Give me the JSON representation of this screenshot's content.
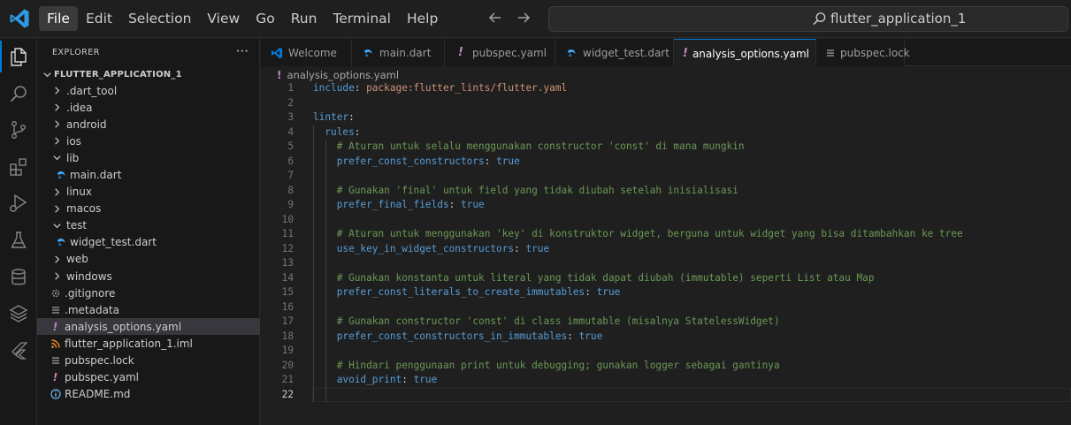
{
  "menu": [
    "File",
    "Edit",
    "Selection",
    "View",
    "Go",
    "Run",
    "Terminal",
    "Help"
  ],
  "search": {
    "text": "flutter_application_1"
  },
  "colors": {
    "accent": "#0078d4",
    "yaml_icon": "#c586c0",
    "dart_icon": "#42a5f5",
    "xml_icon": "#f08a24"
  },
  "explorer": {
    "title": "EXPLORER",
    "more": "···",
    "root": "FLUTTER_APPLICATION_1",
    "items": [
      {
        "label": ".dart_tool",
        "kind": "folder",
        "icon": "chevron-right-icon"
      },
      {
        "label": ".idea",
        "kind": "folder",
        "icon": "chevron-right-icon"
      },
      {
        "label": "android",
        "kind": "folder",
        "icon": "chevron-right-icon"
      },
      {
        "label": "ios",
        "kind": "folder",
        "icon": "chevron-right-icon"
      },
      {
        "label": "lib",
        "kind": "folder-open",
        "icon": "chevron-down-icon"
      },
      {
        "label": "main.dart",
        "kind": "dart",
        "icon": "dart-icon"
      },
      {
        "label": "linux",
        "kind": "folder",
        "icon": "chevron-right-icon"
      },
      {
        "label": "macos",
        "kind": "folder",
        "icon": "chevron-right-icon"
      },
      {
        "label": "test",
        "kind": "folder-open",
        "icon": "chevron-down-icon"
      },
      {
        "label": "widget_test.dart",
        "kind": "dart",
        "icon": "dart-icon"
      },
      {
        "label": "web",
        "kind": "folder",
        "icon": "chevron-right-icon"
      },
      {
        "label": "windows",
        "kind": "folder",
        "icon": "chevron-right-icon"
      },
      {
        "label": ".gitignore",
        "kind": "gear",
        "icon": "gear-icon"
      },
      {
        "label": ".metadata",
        "kind": "lines",
        "icon": "lines-icon"
      },
      {
        "label": "analysis_options.yaml",
        "kind": "yaml",
        "icon": "exclamation-icon",
        "selected": true
      },
      {
        "label": "flutter_application_1.iml",
        "kind": "xml",
        "icon": "rss-icon"
      },
      {
        "label": "pubspec.lock",
        "kind": "lines",
        "icon": "lines-icon"
      },
      {
        "label": "pubspec.yaml",
        "kind": "yaml",
        "icon": "exclamation-icon"
      },
      {
        "label": "README.md",
        "kind": "info",
        "icon": "info-icon"
      }
    ]
  },
  "tabs": [
    {
      "label": "Welcome",
      "kind": "vscode"
    },
    {
      "label": "main.dart",
      "kind": "dart"
    },
    {
      "label": "pubspec.yaml",
      "kind": "yaml"
    },
    {
      "label": "widget_test.dart",
      "kind": "dart"
    },
    {
      "label": "analysis_options.yaml",
      "kind": "yaml",
      "active": true,
      "close": "✕"
    },
    {
      "label": "pubspec.lock",
      "kind": "lines"
    }
  ],
  "breadcrumb": {
    "icon": "!",
    "file": "analysis_options.yaml"
  },
  "code": {
    "current_line": 22,
    "lines": [
      [
        [
          "k",
          "include"
        ],
        [
          "p",
          ": "
        ],
        [
          "v",
          "package:flutter_lints/flutter.yaml"
        ]
      ],
      [],
      [
        [
          "k",
          "linter"
        ],
        [
          "p",
          ":"
        ]
      ],
      [
        [
          "p",
          "  "
        ],
        [
          "k",
          "rules"
        ],
        [
          "p",
          ":"
        ]
      ],
      [
        [
          "p",
          "    "
        ],
        [
          "c",
          "# Aturan untuk selalu menggunakan constructor 'const' di mana mungkin"
        ]
      ],
      [
        [
          "p",
          "    "
        ],
        [
          "k",
          "prefer_const_constructors"
        ],
        [
          "p",
          ": "
        ],
        [
          "b",
          "true"
        ]
      ],
      [],
      [
        [
          "p",
          "    "
        ],
        [
          "c",
          "# Gunakan 'final' untuk field yang tidak diubah setelah inisialisasi"
        ]
      ],
      [
        [
          "p",
          "    "
        ],
        [
          "k",
          "prefer_final_fields"
        ],
        [
          "p",
          ": "
        ],
        [
          "b",
          "true"
        ]
      ],
      [],
      [
        [
          "p",
          "    "
        ],
        [
          "c",
          "# Aturan untuk menggunakan 'key' di konstruktor widget, berguna untuk widget yang bisa ditambahkan ke tree"
        ]
      ],
      [
        [
          "p",
          "    "
        ],
        [
          "k",
          "use_key_in_widget_constructors"
        ],
        [
          "p",
          ": "
        ],
        [
          "b",
          "true"
        ]
      ],
      [],
      [
        [
          "p",
          "    "
        ],
        [
          "c",
          "# Gunakan konstanta untuk literal yang tidak dapat diubah (immutable) seperti List atau Map"
        ]
      ],
      [
        [
          "p",
          "    "
        ],
        [
          "k",
          "prefer_const_literals_to_create_immutables"
        ],
        [
          "p",
          ": "
        ],
        [
          "b",
          "true"
        ]
      ],
      [],
      [
        [
          "p",
          "    "
        ],
        [
          "c",
          "# Gunakan constructor 'const' di class immutable (misalnya StatelessWidget)"
        ]
      ],
      [
        [
          "p",
          "    "
        ],
        [
          "k",
          "prefer_const_constructors_in_immutables"
        ],
        [
          "p",
          ": "
        ],
        [
          "b",
          "true"
        ]
      ],
      [],
      [
        [
          "p",
          "    "
        ],
        [
          "c",
          "# Hindari penggunaan print untuk debugging; gunakan logger sebagai gantinya"
        ]
      ],
      [
        [
          "p",
          "    "
        ],
        [
          "k",
          "avoid_print"
        ],
        [
          "p",
          ": "
        ],
        [
          "b",
          "true"
        ]
      ],
      []
    ]
  }
}
